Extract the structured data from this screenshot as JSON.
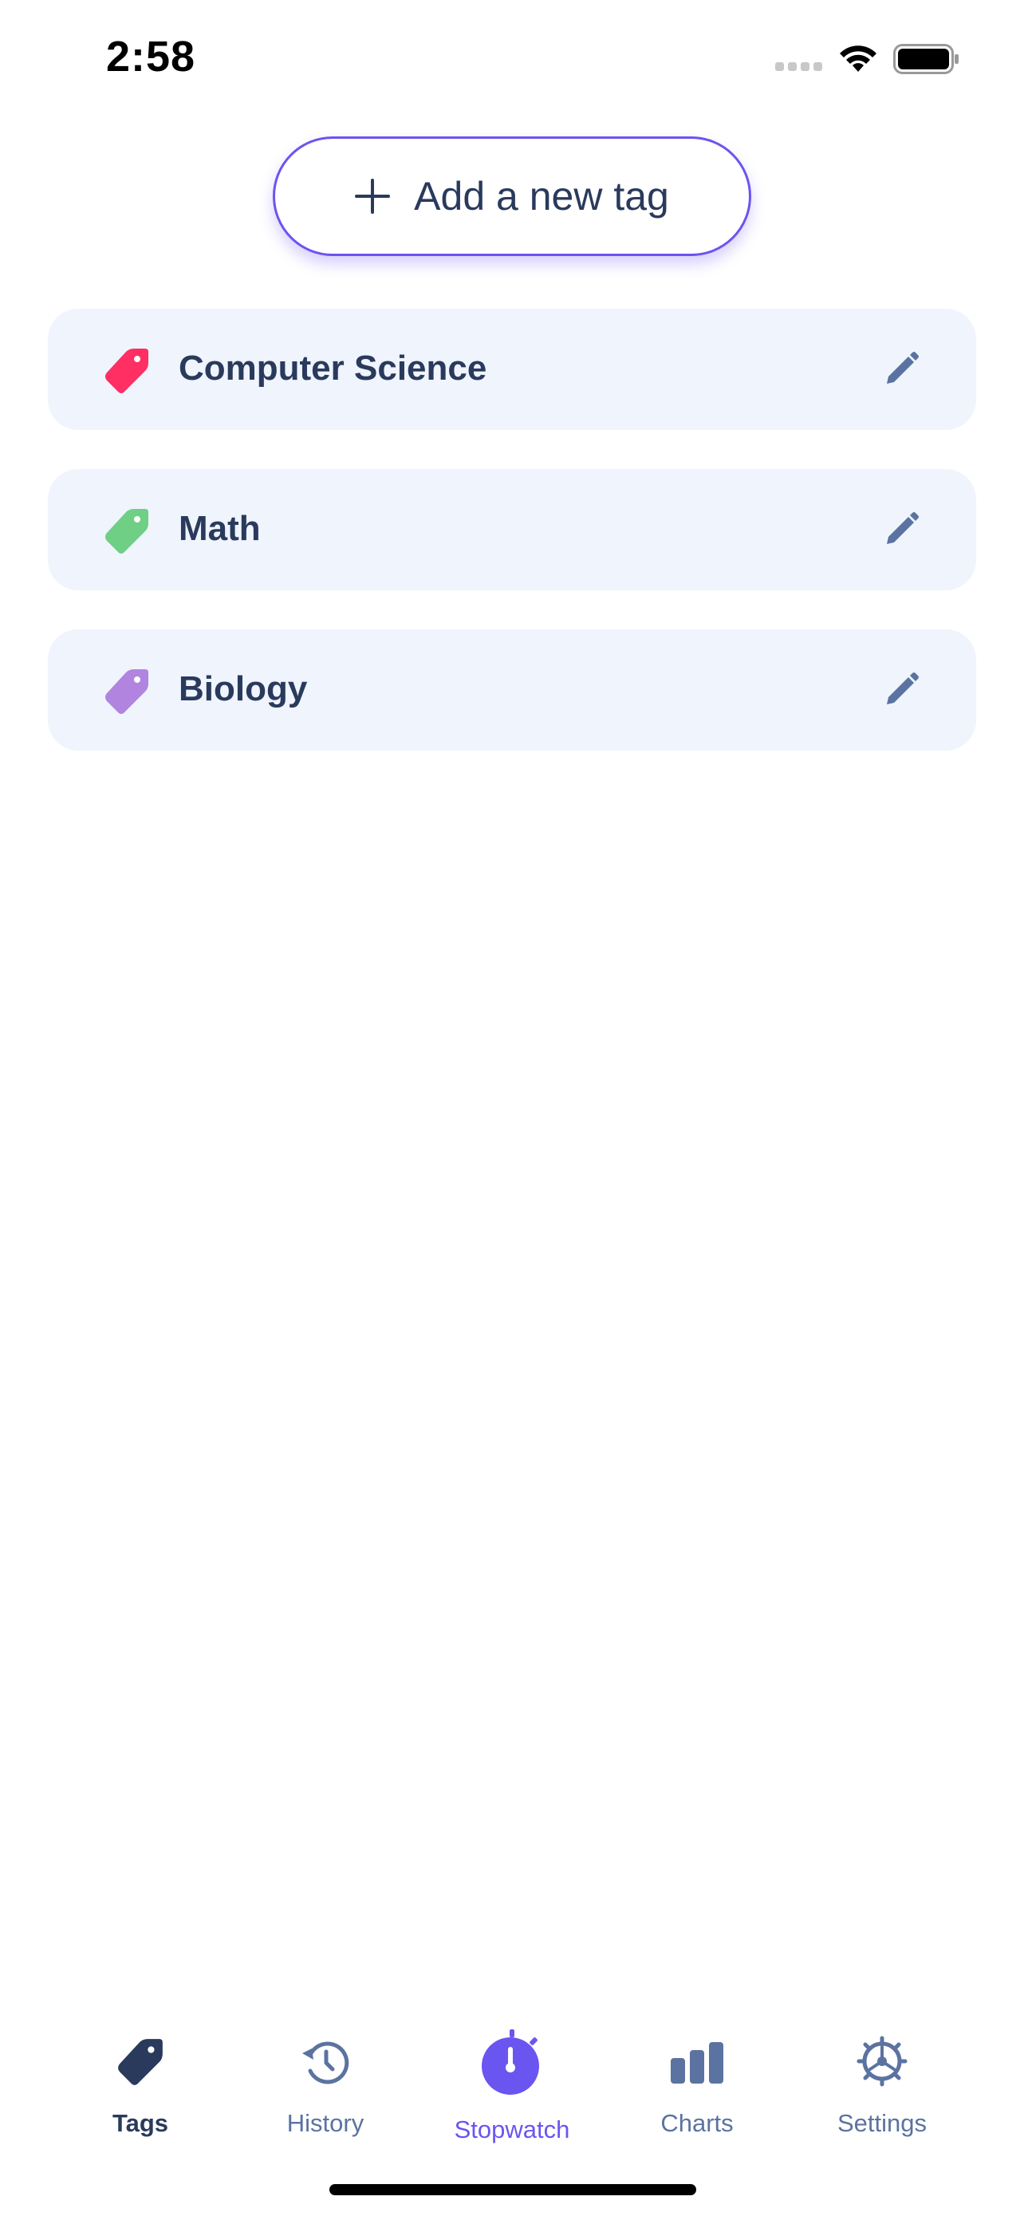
{
  "status_bar": {
    "time": "2:58"
  },
  "add_button": {
    "label": "Add a new tag",
    "icon": "plus-icon"
  },
  "tags": [
    {
      "name": "Computer Science",
      "color": "#ff2e63",
      "icon": "tag-icon",
      "action_icon": "pencil-icon"
    },
    {
      "name": "Math",
      "color": "#6fcf85",
      "icon": "tag-icon",
      "action_icon": "pencil-icon"
    },
    {
      "name": "Biology",
      "color": "#b184e0",
      "icon": "tag-icon",
      "action_icon": "pencil-icon"
    }
  ],
  "tab_bar": {
    "tabs": [
      {
        "label": "Tags",
        "icon": "tag-icon",
        "state": "selected",
        "color": "#2a3a5c"
      },
      {
        "label": "History",
        "icon": "history-icon",
        "state": "normal",
        "color": "#5b73a0"
      },
      {
        "label": "Stopwatch",
        "icon": "stopwatch-icon",
        "state": "accent",
        "color": "#6a55f0"
      },
      {
        "label": "Charts",
        "icon": "bar-chart-icon",
        "state": "normal",
        "color": "#5b73a0"
      },
      {
        "label": "Settings",
        "icon": "gear-icon",
        "state": "normal",
        "color": "#5b73a0"
      }
    ]
  },
  "colors": {
    "accent": "#6a55f0",
    "text_primary": "#2a3a5c",
    "card_background": "#eff4fd",
    "icon_muted": "#5b73a0"
  }
}
